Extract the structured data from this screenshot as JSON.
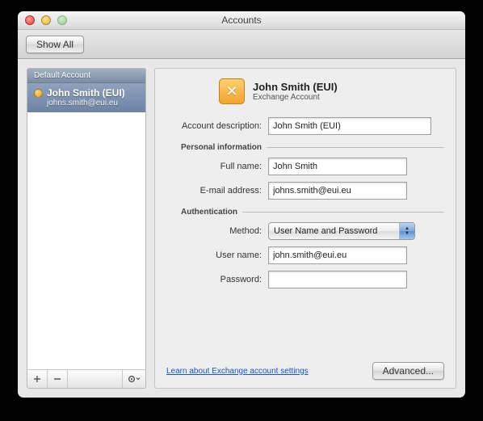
{
  "window": {
    "title": "Accounts"
  },
  "toolbar": {
    "show_all": "Show All"
  },
  "sidebar": {
    "header": "Default Account",
    "item": {
      "name": "John Smith (EUI)",
      "email": "johns.smith@eui.eu"
    }
  },
  "main": {
    "title": "John Smith (EUI)",
    "type": "Exchange Account",
    "labels": {
      "description": "Account description:",
      "personal_info": "Personal information",
      "full_name": "Full name:",
      "email": "E-mail address:",
      "authentication": "Authentication",
      "method": "Method:",
      "user_name": "User name:",
      "password": "Password:"
    },
    "values": {
      "description": "John Smith (EUI)",
      "full_name": "John Smith",
      "email": "johns.smith@eui.eu",
      "method": "User Name and Password",
      "user_name": "john.smith@eui.eu",
      "password": ""
    },
    "link": "Learn about Exchange account settings",
    "advanced": "Advanced..."
  }
}
